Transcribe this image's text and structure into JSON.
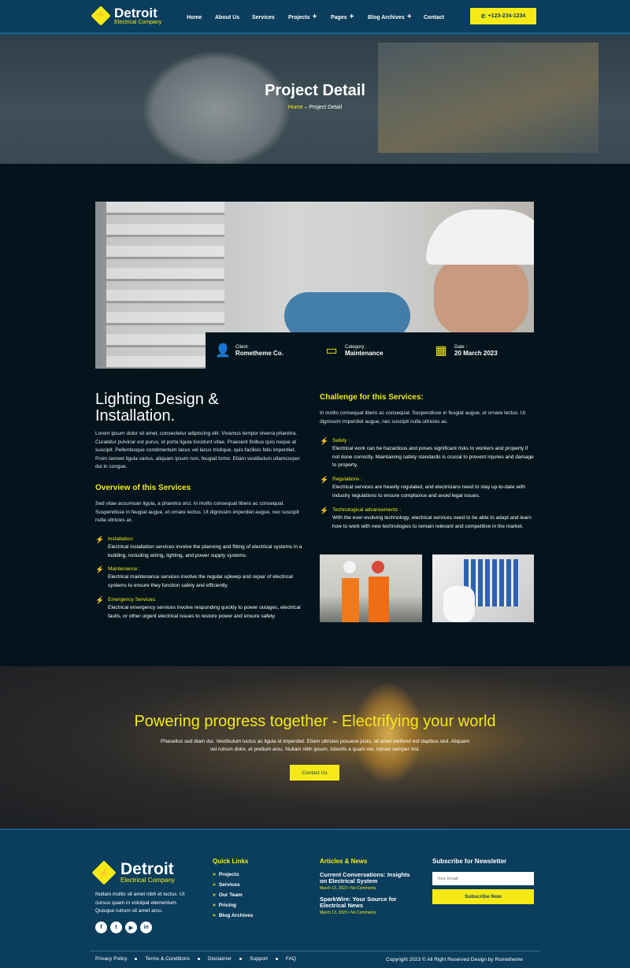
{
  "header": {
    "logo_title": "Detroit",
    "logo_subtitle": "Electrical Company",
    "nav": [
      "Home",
      "About Us",
      "Services",
      "Projects",
      "Pages",
      "Blog Archives",
      "Contact"
    ],
    "phone": "+123-234-1234"
  },
  "hero": {
    "title": "Project Detail",
    "crumb_home": "Home",
    "crumb_sep": "–",
    "crumb_current": "Project Detail"
  },
  "project": {
    "client_label": "Client :",
    "client_value": "Rometheme Co.",
    "category_label": "Category :",
    "category_value": "Maintenance",
    "date_label": "Date :",
    "date_value": "20 March 2023"
  },
  "left": {
    "title": "Lighting Design & Installation.",
    "intro": "Lorem ipsum dolor sit amet, consectetur adipiscing elit. Vivamus tempor viverra pharetra. Curabitur pulvinar est purus, et porta ligula tincidunt vitae. Praesent finibus quis neque at suscipit. Pellentesque condimentum lacus vel lacus tristique, quis facilisis felis imperdiet. Proin laoreet ligula varius, aliquam ipsum non, feugiat tortor. Etiam vestibulum ullamcorper dui in congue.",
    "overview_title": "Overview of this Services",
    "overview_text": "Sed vitae accumsan ligula, a pharetra orci. In mollis consequat libero ac consequat. Suspendisse in feugiat augue, et ornare lectus. Ut dignissim imperdiet augue, nec suscipit nulla ultricies ac.",
    "items": [
      {
        "title": "Installation:",
        "text": "Electrical installation services involve the planning and fitting of electrical systems in a building, including wiring, lighting, and power supply systems."
      },
      {
        "title": "Maintenance :",
        "text": "Electrical maintenance services involve the regular upkeep and repair of electrical systems to ensure they function safely and efficiently."
      },
      {
        "title": "Emergency Services:",
        "text": "Electrical emergency services involve responding quickly to power outages, electrical faults, or other urgent electrical issues to restore power and ensure safety."
      }
    ]
  },
  "right": {
    "title": "Challenge for this Services:",
    "intro": "In mollis consequat libero ac consequat. Suspendisse in feugiat augue, et ornare lectus. Ut dignissim imperdiet augue, nec suscipit nulla ultricies ac.",
    "items": [
      {
        "title": "Safety :",
        "text": "Electrical work can be hazardous and poses significant risks to workers and property if not done correctly. Maintaining safety standards is crucial to prevent injuries and damage to property."
      },
      {
        "title": "Regulations :",
        "text": "Electrical services are heavily regulated, and electricians need to stay up-to-date with industry regulations to ensure compliance and avoid legal issues."
      },
      {
        "title": "Technological advancements :",
        "text": "With the ever-evolving technology, electrical services need to be able to adapt and learn how to work with new technologies to remain relevant and competitive in the market."
      }
    ]
  },
  "cta": {
    "title": "Powering progress together - Electrifying your world",
    "text": "Phasellus sed diam dui. Vestibulum luctus ac ligula id imperdiet. Etiam ultricies posuere justo, sit amet eleifend est dapibus sed. Aliquam vel rutrum dolor, et pretium arcu. Nullam nibh ipsum, lobortis a quam vel, rutrum semper nisl.",
    "button": "Contact Us"
  },
  "footer": {
    "logo_title": "Detroit",
    "logo_subtitle": "Electrical Company",
    "about": "Nullam mollis sit amet nibh et luctus. Ut cursus quam in volutpat elementum. Quisque rutrum sit amet arcu.",
    "social": [
      "f",
      "t",
      "▶",
      "in"
    ],
    "quick_links_title": "Quick Links",
    "quick_links": [
      "Projects",
      "Services",
      "Our Team",
      "Pricing",
      "Blog Archives"
    ],
    "news_title": "Articles & News",
    "news": [
      {
        "title": "Current Conversations: Insights on Electrical System",
        "meta": "March 13, 2023 • No Comments"
      },
      {
        "title": "SparkWire: Your Source for Electrical News",
        "meta": "March 13, 2023 • No Comments"
      }
    ],
    "newsletter_title": "Subscribe for Newsletter",
    "email_placeholder": "Your Email",
    "subscribe": "Subscribe Now",
    "bottom_links": [
      "Privacy Policy",
      "Terms & Conditions",
      "Disclaimer",
      "Support",
      "FAQ"
    ],
    "copyright": "Copyright 2023 © All Right Reserved Design by Rometheme"
  },
  "colors": {
    "accent": "#f5ea17",
    "navy": "#0b3d5c",
    "dark": "#03141d"
  }
}
